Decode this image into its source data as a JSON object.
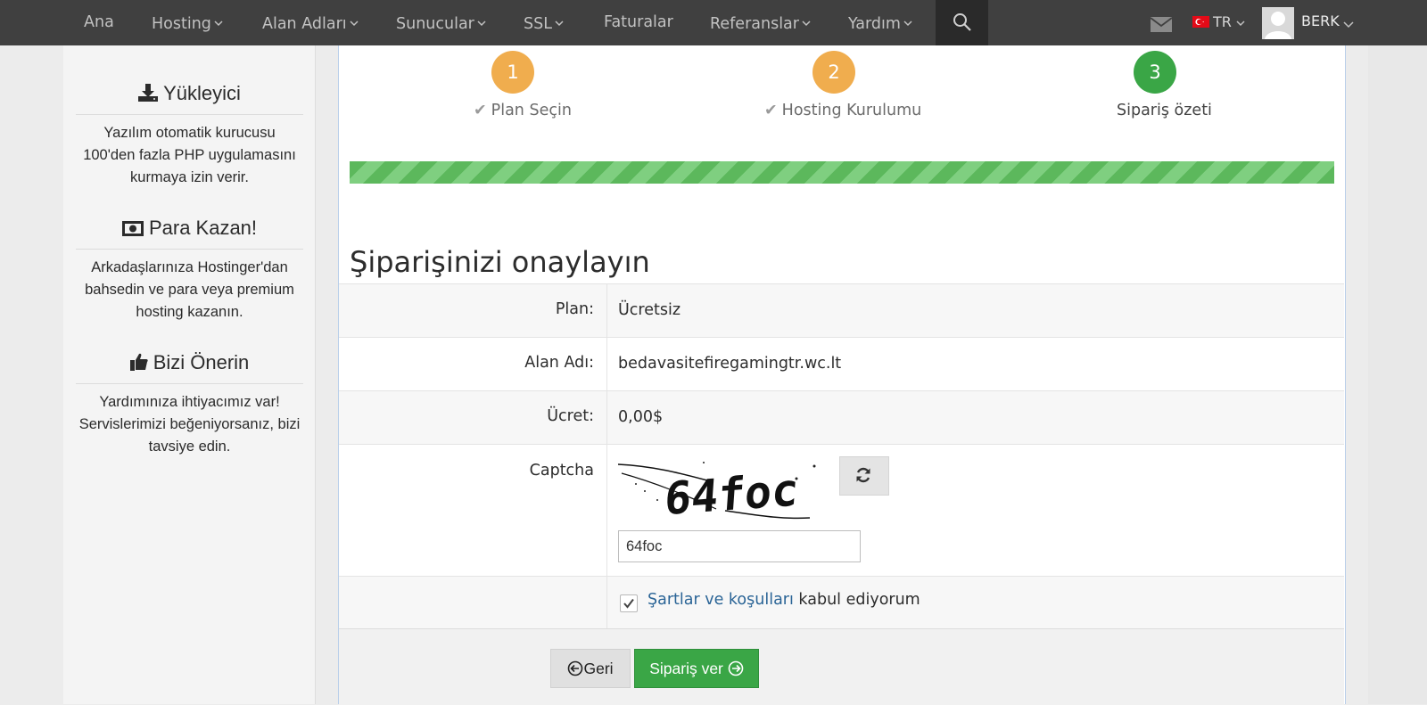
{
  "nav": {
    "items": [
      {
        "label": "Ana",
        "dropdown": false
      },
      {
        "label": "Hosting",
        "dropdown": true
      },
      {
        "label": "Alan Adları",
        "dropdown": true
      },
      {
        "label": "Sunucular",
        "dropdown": true
      },
      {
        "label": "SSL",
        "dropdown": true
      },
      {
        "label": "Faturalar",
        "dropdown": false
      },
      {
        "label": "Referanslar",
        "dropdown": true
      },
      {
        "label": "Yardım",
        "dropdown": true
      }
    ],
    "language": "TR",
    "username": "BERK",
    "icons": [
      "search-icon",
      "mail-icon",
      "turkey-flag-icon",
      "avatar",
      "chevron-down-icon"
    ]
  },
  "sidebar": {
    "sections": [
      {
        "icon": "download-icon",
        "title": "Yükleyici",
        "text": "Yazılım otomatik kurucusu 100'den fazla PHP uygulamasını kurmaya izin verir."
      },
      {
        "icon": "money-icon",
        "title": "Para Kazan!",
        "text": "Arkadaşlarınıza Hostinger'dan bahsedin ve para veya premium hosting kazanın."
      },
      {
        "icon": "thumbs-up-icon",
        "title": "Bizi Önerin",
        "text": "Yardımınıza ihtiyacımız var! Servislerimizi beğeniyorsanız, bizi tavsiye edin."
      }
    ]
  },
  "steps": [
    {
      "number": "1",
      "label": "Plan Seçin",
      "status": "done",
      "color": "#f0ad4e"
    },
    {
      "number": "2",
      "label": "Hosting Kurulumu",
      "status": "done",
      "color": "#f0ad4e"
    },
    {
      "number": "3",
      "label": "Sipariş özeti",
      "status": "current",
      "color": "#3aa646"
    }
  ],
  "progress_percent": 100,
  "confirm_title": "Şiparişinizi onaylayın",
  "form": {
    "plan_label": "Plan:",
    "plan_value": "Ücretsiz",
    "domain_label": "Alan Adı:",
    "domain_value": "bedavasitefiregamingtr.wc.lt",
    "price_label": "Ücret:",
    "price_value": "0,00$",
    "captcha_label": "Captcha",
    "captcha_image_text": "64foc",
    "captcha_input_value": "64foc",
    "terms_checked": true,
    "terms_link": "Şartlar ve koşulları",
    "terms_text": " kabul ediyorum"
  },
  "buttons": {
    "back_label": "Geri",
    "order_label": "Sipariş ver"
  },
  "colors": {
    "nav_bg": "#404040",
    "accent_green": "#3aa646",
    "step_orange": "#f0ad4e",
    "link_blue": "#2a6496"
  }
}
